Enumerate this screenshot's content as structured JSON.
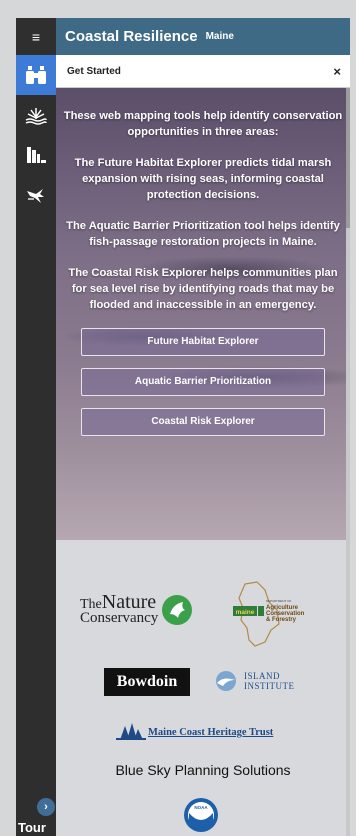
{
  "header": {
    "menu_icon": "hamburger-icon",
    "title": "Coastal Resilience",
    "subtitle": "Maine",
    "color": "#3e6a85"
  },
  "rail": {
    "items": [
      {
        "icon": "binoculars-icon",
        "active": true
      },
      {
        "icon": "marsh-grass-icon",
        "active": false
      },
      {
        "icon": "buildings-icon",
        "active": false
      },
      {
        "icon": "heron-icon",
        "active": false
      }
    ],
    "tour_icon": "chevron-right-icon",
    "tour_label": "Tour"
  },
  "panel": {
    "title": "Get Started",
    "close_label": "×",
    "paragraphs": [
      "These web mapping tools help identify conservation opportunities in three areas:",
      "The Future Habitat Explorer predicts tidal marsh expansion with rising seas, informing coastal protection decisions.",
      "The Aquatic Barrier Prioritization tool helps identify fish-passage restoration projects in Maine.",
      "The Coastal Risk Explorer helps communities plan for sea level rise by identifying roads that may be flooded and inaccessible in an emergency."
    ],
    "buttons": [
      "Future Habitat Explorer",
      "Aquatic Barrier Prioritization",
      "Coastal Risk Explorer"
    ]
  },
  "partners": {
    "tnc": {
      "the": "The",
      "nature": "Nature",
      "conservancy": "Conservancy"
    },
    "maine_dept": {
      "line0": "DEPARTMENT OF",
      "line1": "Agriculture",
      "line2": "Conservation",
      "line3": "& Forestry",
      "badge": "maine"
    },
    "bowdoin": "Bowdoin",
    "island": {
      "line1": "ISLAND",
      "line2": "INSTITUTE"
    },
    "mcht": "Maine Coast Heritage Trust",
    "bluesky": "Blue Sky Planning Solutions",
    "noaa": "NOAA"
  }
}
